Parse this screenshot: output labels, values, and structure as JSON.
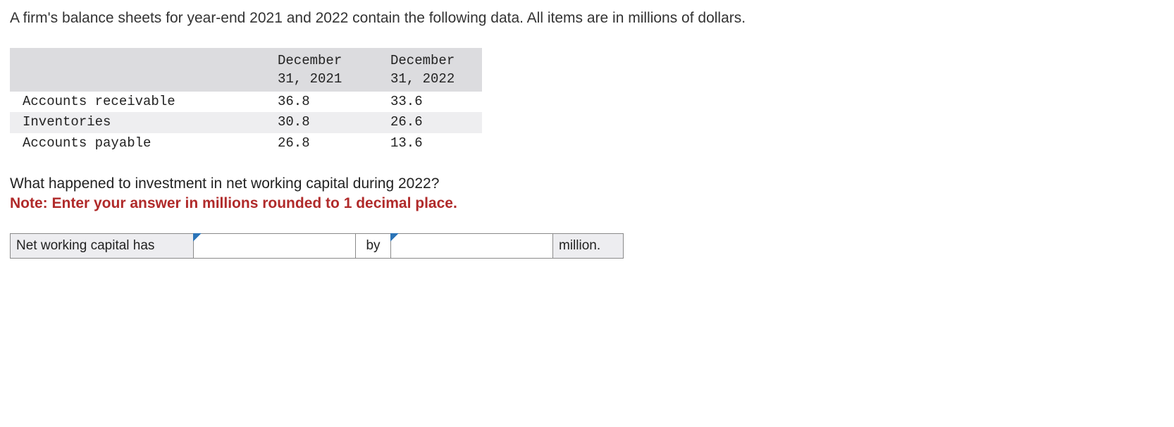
{
  "intro": "A firm's balance sheets for year-end 2021 and 2022 contain the following data. All items are in millions of dollars.",
  "table": {
    "header": {
      "c1": "December 31, 2021",
      "c2": "December 31, 2022"
    },
    "header_lines": {
      "c1a": "December",
      "c1b": "31, 2021",
      "c2a": "December",
      "c2b": "31, 2022"
    },
    "rows": [
      {
        "label": "Accounts receivable",
        "v1": "36.8",
        "v2": "33.6"
      },
      {
        "label": "Inventories",
        "v1": "30.8",
        "v2": "26.6"
      },
      {
        "label": "Accounts payable",
        "v1": "26.8",
        "v2": "13.6"
      }
    ]
  },
  "question": "What happened to investment in net working capital during 2022?",
  "note": "Note: Enter your answer in millions rounded to 1 decimal place.",
  "answer": {
    "prefix": "Net working capital has",
    "direction_value": "",
    "middle": "by",
    "amount_value": "",
    "unit": "million."
  }
}
